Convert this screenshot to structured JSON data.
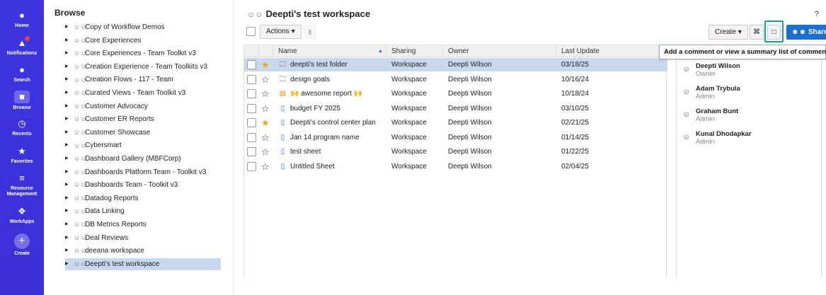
{
  "rail": {
    "items": [
      {
        "label": "Home",
        "icon": "home-icon"
      },
      {
        "label": "Notifications",
        "icon": "bell-icon"
      },
      {
        "label": "Search",
        "icon": "search-icon"
      },
      {
        "label": "Browse",
        "icon": "folder-icon"
      },
      {
        "label": "Recents",
        "icon": "clock-icon"
      },
      {
        "label": "Favorites",
        "icon": "star-icon"
      },
      {
        "label": "Resource",
        "label2": "Management",
        "icon": "people-icon"
      },
      {
        "label": "WorkApps",
        "icon": "workapps-icon"
      },
      {
        "label": "Create",
        "icon": "plus-icon"
      }
    ]
  },
  "browse": {
    "title": "Browse",
    "items": [
      "Copy of Workflow Demos",
      "Core Experiences",
      "Core Experiences - Team Toolkit v3",
      "Creation Experience - Team Toolkits v3",
      "Creation Flows - 117 - Team",
      "Curated Views - Team Toolkit v3",
      "Customer Advocacy",
      "Customer ER Reports",
      "Customer Showcase",
      "Cybersmart",
      "Dashboard Gallery (MBFCorp)",
      "Dashboards Platform Team - Toolkit v3",
      "Dashboards Team - Toolkit v3",
      "Datadog Reports",
      "Data Linking",
      "DB Metrics Reports",
      "Deal Reviews",
      "deeana workspace",
      "Deepti's test workspace"
    ],
    "selected_index": 18
  },
  "workspace": {
    "title": "Deepti's test workspace",
    "help": "?"
  },
  "toolbar": {
    "actions_label": "Actions ▾",
    "create_label": "Create ▾",
    "share_label": "Share",
    "tooltip": "Add a comment or view a summary list of comments."
  },
  "table": {
    "headers": {
      "name": "Name",
      "sharing": "Sharing",
      "owner": "Owner",
      "last_update": "Last Update"
    },
    "rows": [
      {
        "name": "deepti's test folder",
        "type": "folder",
        "starred": true,
        "sharing": "Workspace",
        "owner": "Deepti Wilson",
        "updated": "03/18/25",
        "selected": true
      },
      {
        "name": "design goals",
        "type": "folder",
        "starred": false,
        "sharing": "Workspace",
        "owner": "Deepti Wilson",
        "updated": "10/16/24"
      },
      {
        "name": "🙌 awesome report 🙌",
        "type": "report",
        "starred": false,
        "sharing": "Workspace",
        "owner": "Deepti Wilson",
        "updated": "10/18/24"
      },
      {
        "name": "budget FY 2025",
        "type": "sheet",
        "starred": false,
        "sharing": "Workspace",
        "owner": "Deepti Wilson",
        "updated": "03/10/25"
      },
      {
        "name": "Deepti's control center plan",
        "type": "sheet",
        "starred": true,
        "sharing": "Workspace",
        "owner": "Deepti Wilson",
        "updated": "02/21/25"
      },
      {
        "name": "Jan 14 program name",
        "type": "sheet",
        "starred": false,
        "sharing": "Workspace",
        "owner": "Deepti Wilson",
        "updated": "01/14/25"
      },
      {
        "name": "test sheet",
        "type": "sheet",
        "starred": false,
        "sharing": "Workspace",
        "owner": "Deepti Wilson",
        "updated": "01/22/25"
      },
      {
        "name": "Untitled Sheet",
        "type": "sheet",
        "starred": false,
        "sharing": "Workspace",
        "owner": "Deepti Wilson",
        "updated": "02/04/25"
      }
    ]
  },
  "members": [
    {
      "name": "Deepti Wilson",
      "role": "Owner"
    },
    {
      "name": "Adam Trybula",
      "role": "Admin"
    },
    {
      "name": "Graham Bunt",
      "role": "Admin"
    },
    {
      "name": "Kunal Dhodapkar",
      "role": "Admin"
    }
  ],
  "colors": {
    "rail": "#3b2fd6",
    "accent": "#1a6fd1",
    "selection": "#c7d8ef",
    "star": "#f0a31a",
    "highlight_frame": "#16a085"
  }
}
